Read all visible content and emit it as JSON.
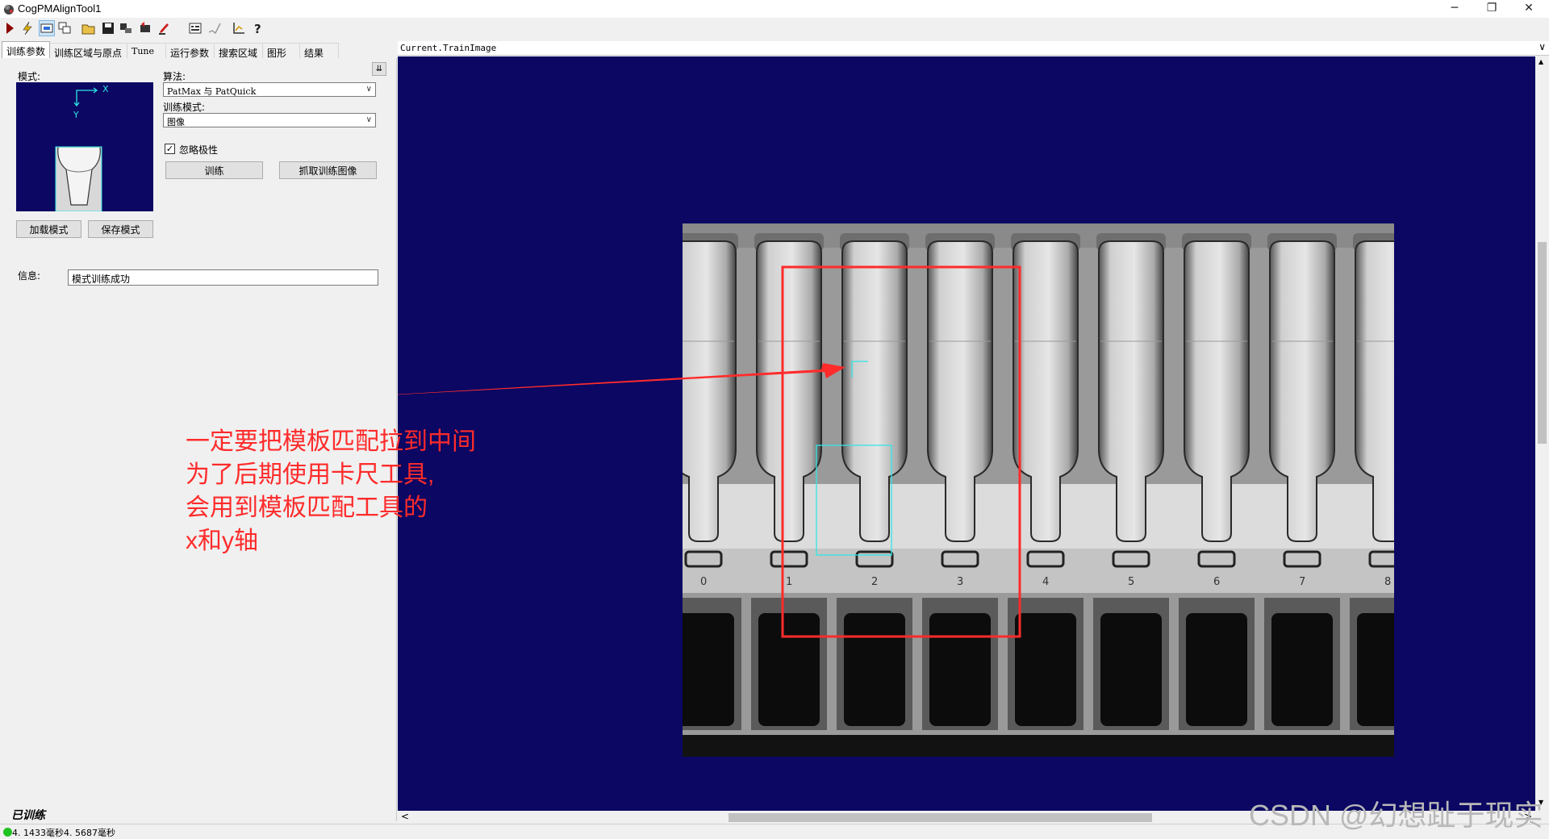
{
  "window": {
    "title": "CogPMAlignTool1",
    "minimize": "─",
    "restore": "❐",
    "close": "✕"
  },
  "toolbar": {
    "icons": [
      "run-icon",
      "electric-icon",
      "image-source-icon",
      "multi-image-icon",
      "open-icon",
      "save-icon",
      "tool-icon",
      "reset-icon",
      "edit-icon",
      "chart-icon",
      "check-icon",
      "graph-icon",
      "help-icon"
    ]
  },
  "tabs": [
    "训练参数",
    "训练区域与原点",
    "Tune",
    "运行参数",
    "搜索区域",
    "图形",
    "结果"
  ],
  "train_params": {
    "pattern_label": "模式:",
    "axis_x": "X",
    "axis_y": "Y",
    "algorithm_label": "算法:",
    "algorithm_value": "PatMax 与 PatQuick",
    "train_mode_label": "训练模式:",
    "train_mode_value": "图像",
    "ignore_polarity_label": "忽略极性",
    "ignore_polarity_checked": true,
    "train_button": "训练",
    "grab_button": "抓取训练图像",
    "load_button": "加载模式",
    "save_button": "保存模式",
    "collapse_button": "⇊",
    "info_label": "信息:",
    "info_value": "模式训练成功",
    "trained_status": "已训练"
  },
  "display": {
    "image_name": "Current.TrainImage",
    "dropdown_arrow": "∨",
    "scroll_up": "▲",
    "scroll_down": "▼",
    "scroll_left": "<",
    "scroll_right": ">",
    "vial_numbers": [
      "0",
      "1",
      "2",
      "3",
      "4",
      "5",
      "6",
      "7",
      "8"
    ]
  },
  "annotation": {
    "lines": [
      "一定要把模板匹配拉到中间",
      "为了后期使用卡尺工具,",
      "会用到模板匹配工具的",
      "x和y轴"
    ],
    "color": "#ff2b2b"
  },
  "status": {
    "timing": "4. 1433毫秒4. 5687毫秒",
    "indicator_color": "#1fc21f"
  },
  "watermark": "CSDN @幻想趾于现实",
  "colors": {
    "display_bg": "#0b0763",
    "roi_cyan": "#2fe6e6",
    "annotation_red": "#ff2b2b"
  }
}
